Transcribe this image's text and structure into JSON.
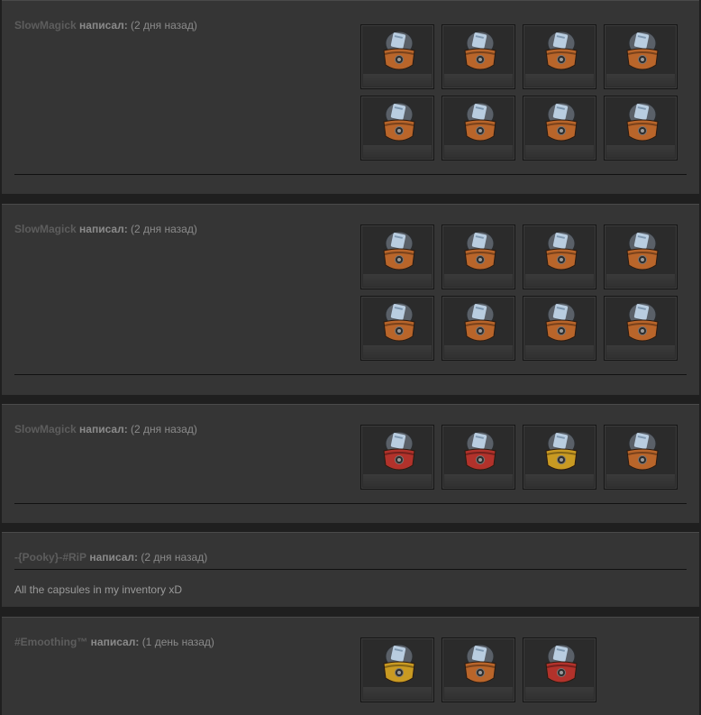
{
  "posts": [
    {
      "author": "SlowMagick",
      "verb": "написал:",
      "time": "(2 дня назад)",
      "items": [
        {
          "icon": "capsule-icon",
          "color": "#b9652a"
        },
        {
          "icon": "capsule-icon",
          "color": "#b9652a"
        },
        {
          "icon": "capsule-icon",
          "color": "#b9652a"
        },
        {
          "icon": "capsule-icon",
          "color": "#b9652a"
        },
        {
          "icon": "capsule-icon",
          "color": "#b9652a"
        },
        {
          "icon": "capsule-icon",
          "color": "#b9652a"
        },
        {
          "icon": "capsule-icon",
          "color": "#b9652a"
        },
        {
          "icon": "capsule-icon",
          "color": "#b9652a"
        }
      ]
    },
    {
      "author": "SlowMagick",
      "verb": "написал:",
      "time": "(2 дня назад)",
      "items": [
        {
          "icon": "capsule-icon",
          "color": "#b9652a"
        },
        {
          "icon": "capsule-icon",
          "color": "#b9652a"
        },
        {
          "icon": "capsule-icon",
          "color": "#b9652a"
        },
        {
          "icon": "capsule-icon",
          "color": "#b9652a"
        },
        {
          "icon": "capsule-icon",
          "color": "#b9652a"
        },
        {
          "icon": "capsule-icon",
          "color": "#b9652a"
        },
        {
          "icon": "capsule-icon",
          "color": "#b9652a"
        },
        {
          "icon": "capsule-icon",
          "color": "#b9652a"
        }
      ]
    },
    {
      "author": "SlowMagick",
      "verb": "написал:",
      "time": "(2 дня назад)",
      "items": [
        {
          "icon": "capsule-icon",
          "color": "#b2322b"
        },
        {
          "icon": "capsule-icon",
          "color": "#b2322b"
        },
        {
          "icon": "capsule-icon",
          "color": "#c99a22"
        },
        {
          "icon": "capsule-icon",
          "color": "#b9652a"
        }
      ]
    },
    {
      "author": "-{Pooky}-#RiP",
      "verb": "написал:",
      "time": "(2 дня назад)",
      "body": "All the capsules in my inventory xD",
      "items": []
    },
    {
      "author": "#Emoothing™",
      "verb": "написал:",
      "time": "(1 день назад)",
      "items": [
        {
          "icon": "capsule-icon",
          "color": "#c99a22"
        },
        {
          "icon": "capsule-icon",
          "color": "#b9652a"
        },
        {
          "icon": "capsule-icon",
          "color": "#b2322b"
        }
      ]
    }
  ]
}
